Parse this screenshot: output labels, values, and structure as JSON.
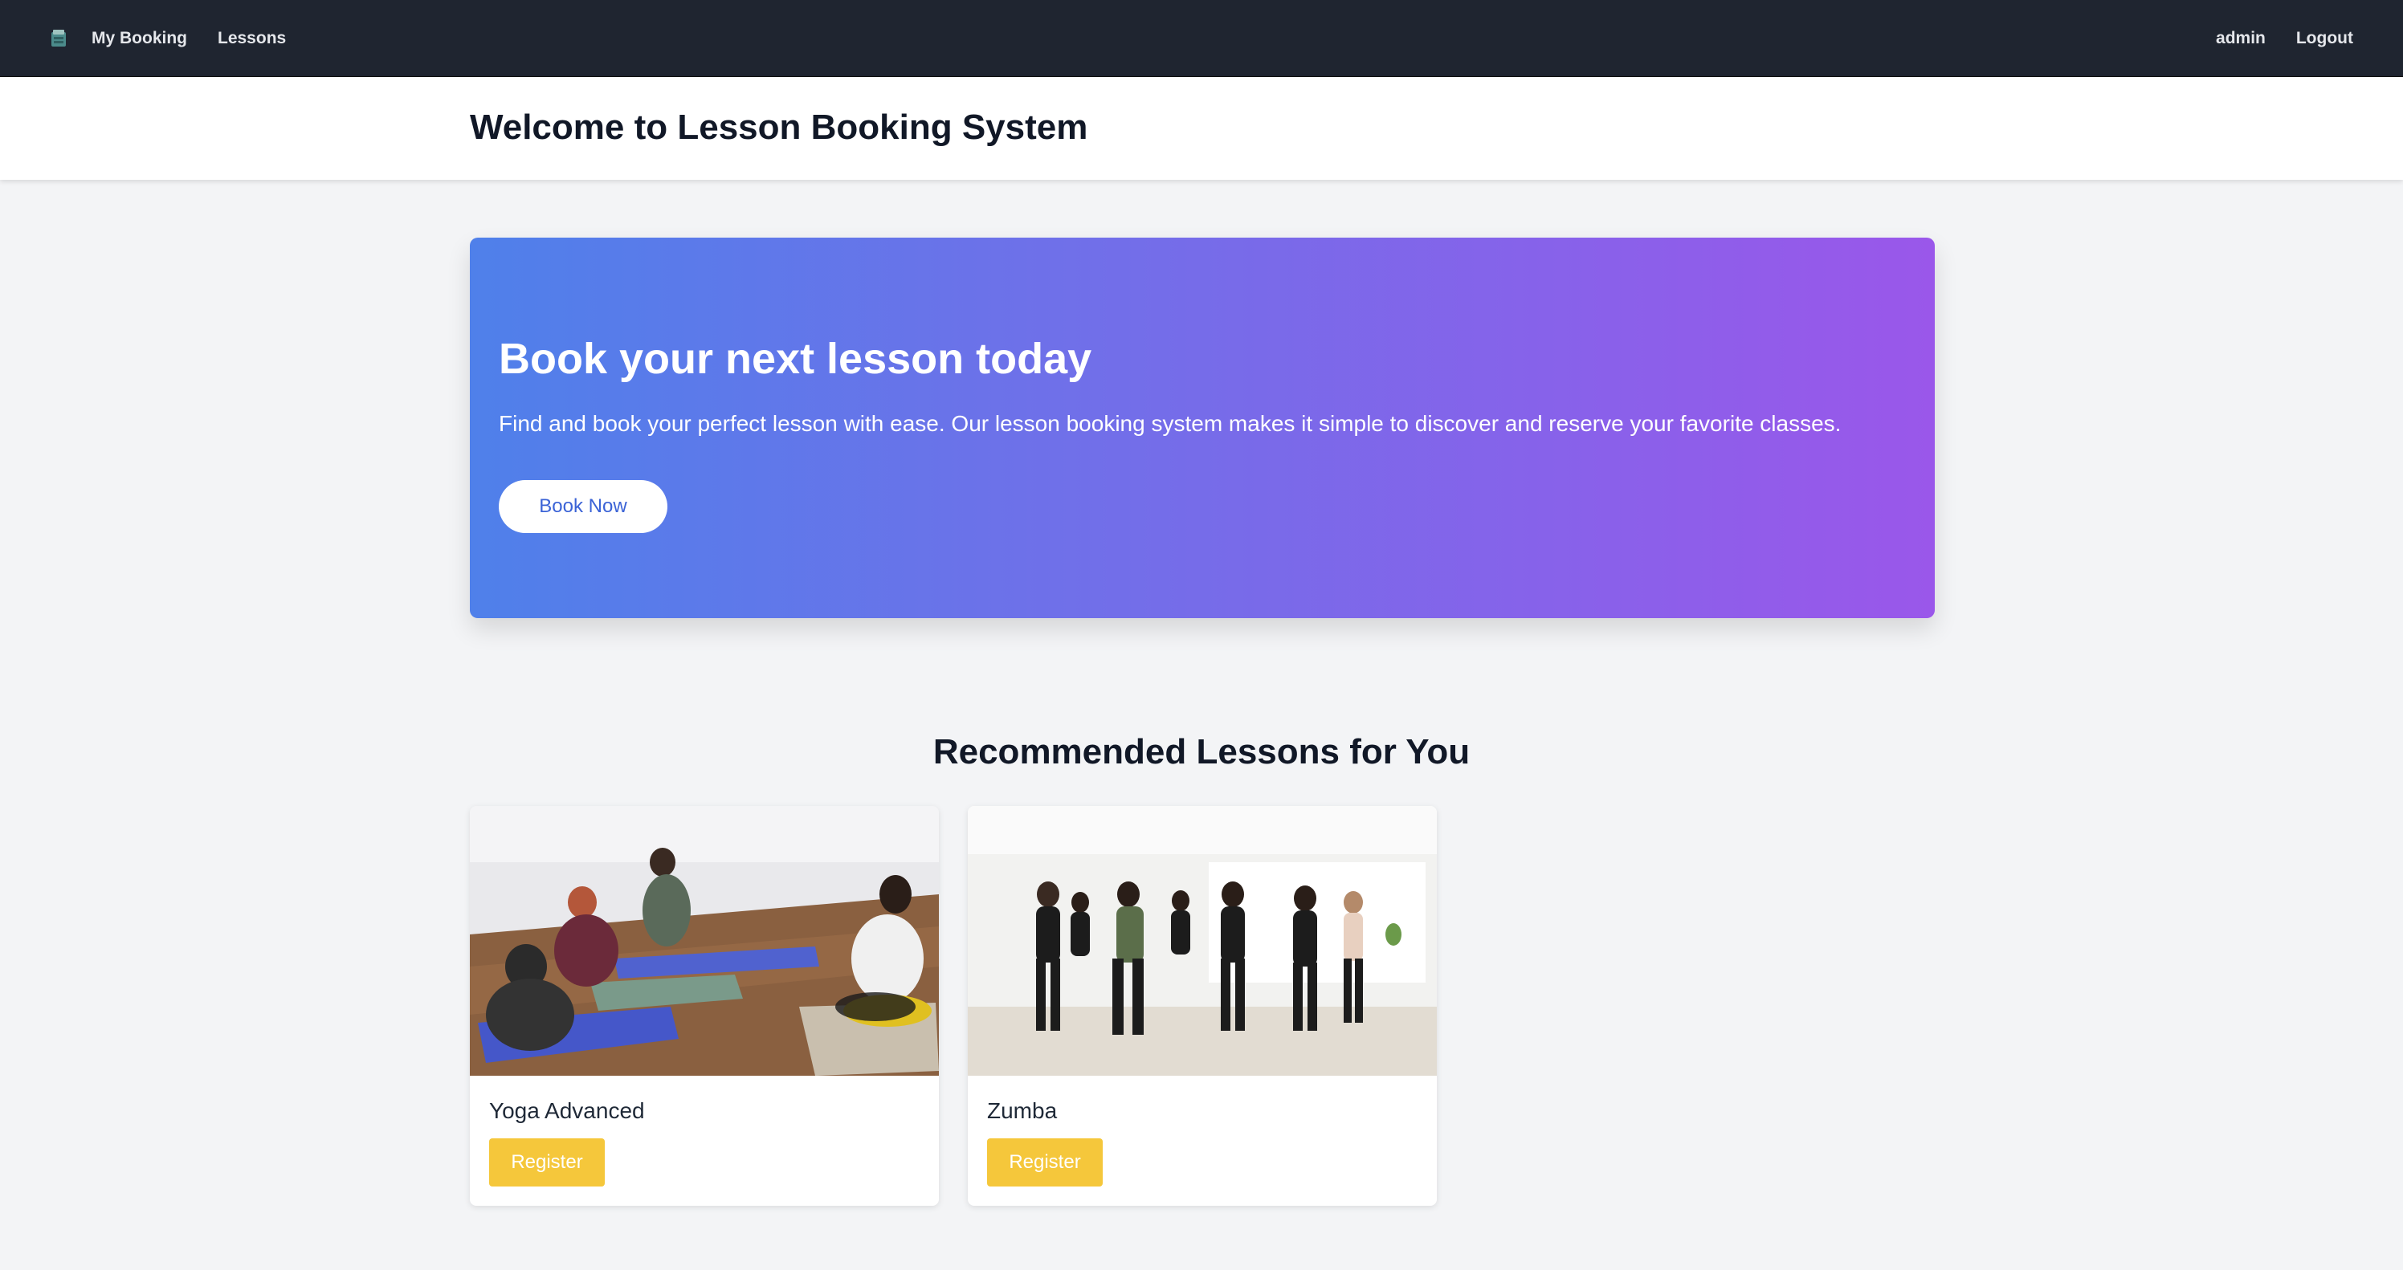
{
  "nav": {
    "logo": "app-logo-icon",
    "links": [
      "My Booking",
      "Lessons"
    ],
    "user": "admin",
    "logout": "Logout"
  },
  "header": {
    "title": "Welcome to Lesson Booking System"
  },
  "hero": {
    "title": "Book your next lesson today",
    "text": "Find and book your perfect lesson with ease. Our lesson booking system makes it simple to discover and reserve your favorite classes.",
    "button": "Book Now",
    "gradient": [
      "#4f80ea",
      "#9a57ea"
    ]
  },
  "recommended": {
    "title": "Recommended Lessons for You",
    "lessons": [
      {
        "name": "Yoga Advanced",
        "button": "Register",
        "image": "yoga-class-photo"
      },
      {
        "name": "Zumba",
        "button": "Register",
        "image": "zumba-class-photo"
      }
    ]
  },
  "colors": {
    "nav_bg": "#1f2530",
    "register": "#f5c73b",
    "page_bg": "#f3f4f6"
  }
}
